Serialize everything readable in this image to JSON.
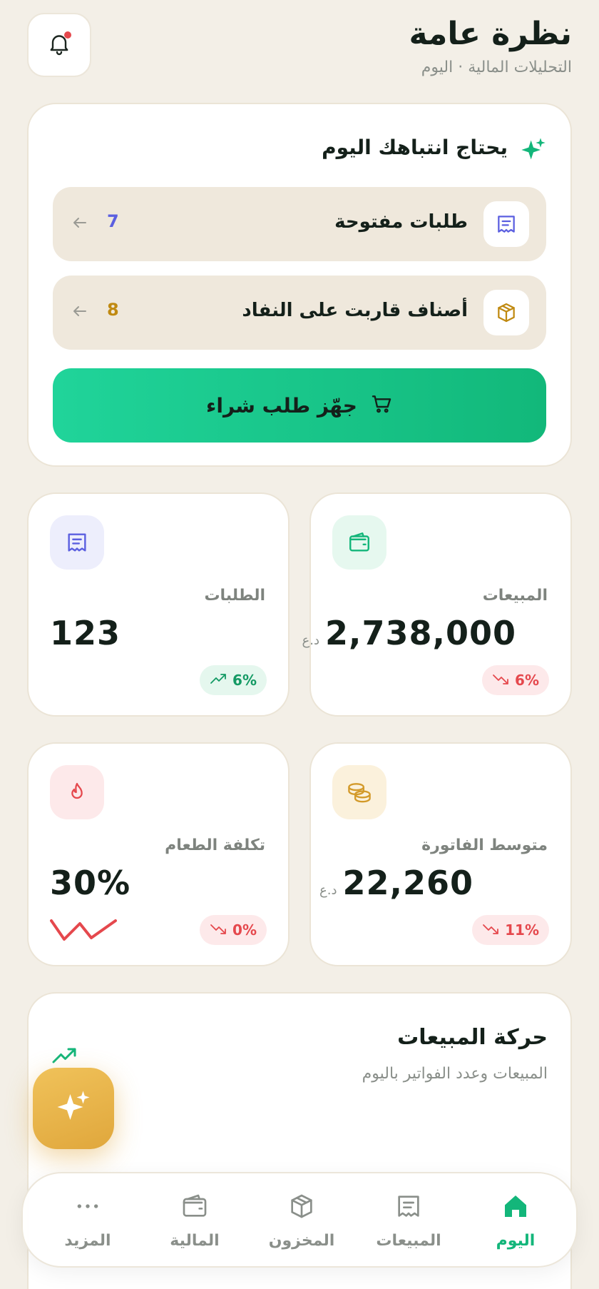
{
  "header": {
    "title": "نظرة عامة",
    "subtitle": "التحليلات المالية · اليوم",
    "notification_icon": "bell-icon"
  },
  "attention": {
    "title": "يحتاج انتباهك اليوم",
    "icon": "sparkle-icon",
    "items": [
      {
        "label": "طلبات مفتوحة",
        "count": "7",
        "icon": "receipt-icon",
        "count_color": "#5b5fe0"
      },
      {
        "label": "أصناف قاربت على النفاد",
        "count": "8",
        "icon": "box-icon",
        "count_color": "#c08a12"
      }
    ],
    "cta_label": "جهّز طلب شراء",
    "cta_icon": "cart-icon"
  },
  "kpis": {
    "sales": {
      "label": "المبيعات",
      "value": "2,738,000",
      "currency": "د.ع",
      "change": "6%",
      "trend": "down",
      "icon": "wallet-icon"
    },
    "orders": {
      "label": "الطلبات",
      "value": "123",
      "change": "6%",
      "trend": "up",
      "icon": "receipt-icon"
    },
    "avg_invoice": {
      "label": "متوسط الفاتورة",
      "value": "22,260",
      "currency": "د.ع",
      "change": "11%",
      "trend": "down",
      "icon": "coins-icon"
    },
    "food_cost": {
      "label": "تكلفة الطعام",
      "value": "30%",
      "change": "0%",
      "trend": "down",
      "icon": "flame-icon"
    }
  },
  "movement": {
    "title": "حركة المبيعات",
    "subtitle": "المبيعات وعدد الفواتير باليوم"
  },
  "nav": {
    "items": [
      {
        "label": "اليوم",
        "icon": "home-icon",
        "active": true
      },
      {
        "label": "المبيعات",
        "icon": "receipt-icon",
        "active": false
      },
      {
        "label": "المخزون",
        "icon": "box-icon",
        "active": false
      },
      {
        "label": "المالية",
        "icon": "wallet-icon",
        "active": false
      },
      {
        "label": "المزيد",
        "icon": "more-icon",
        "active": false
      }
    ]
  },
  "colors": {
    "accent_green": "#13b67a",
    "danger": "#e5484d",
    "gold": "#e0a73c",
    "background": "#f3efe7"
  }
}
